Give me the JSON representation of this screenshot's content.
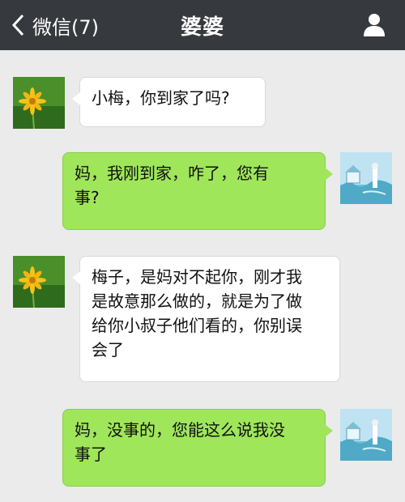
{
  "header": {
    "back_label": "微信(7)",
    "title": "婆婆"
  },
  "messages": [
    {
      "side": "in",
      "avatar": "flower-avatar",
      "text": "小梅，你到家了吗?"
    },
    {
      "side": "out",
      "avatar": "landscape-avatar",
      "text": "妈，我刚到家，咋了，您有\n事?"
    },
    {
      "side": "in",
      "avatar": "flower-avatar",
      "text": "梅子，是妈对不起你，刚才我\n是故意那么做的，就是为了做\n给你小叔子他们看的，你别误\n会了"
    },
    {
      "side": "out",
      "avatar": "landscape-avatar",
      "text": "妈，没事的，您能这么说我没\n事了"
    }
  ],
  "colors": {
    "header_bg": "#36393d",
    "chat_bg": "#ebebeb",
    "incoming_bubble": "#ffffff",
    "outgoing_bubble": "#9fe65b"
  },
  "icons": {
    "back": "chevron-left-icon",
    "profile": "person-icon"
  }
}
